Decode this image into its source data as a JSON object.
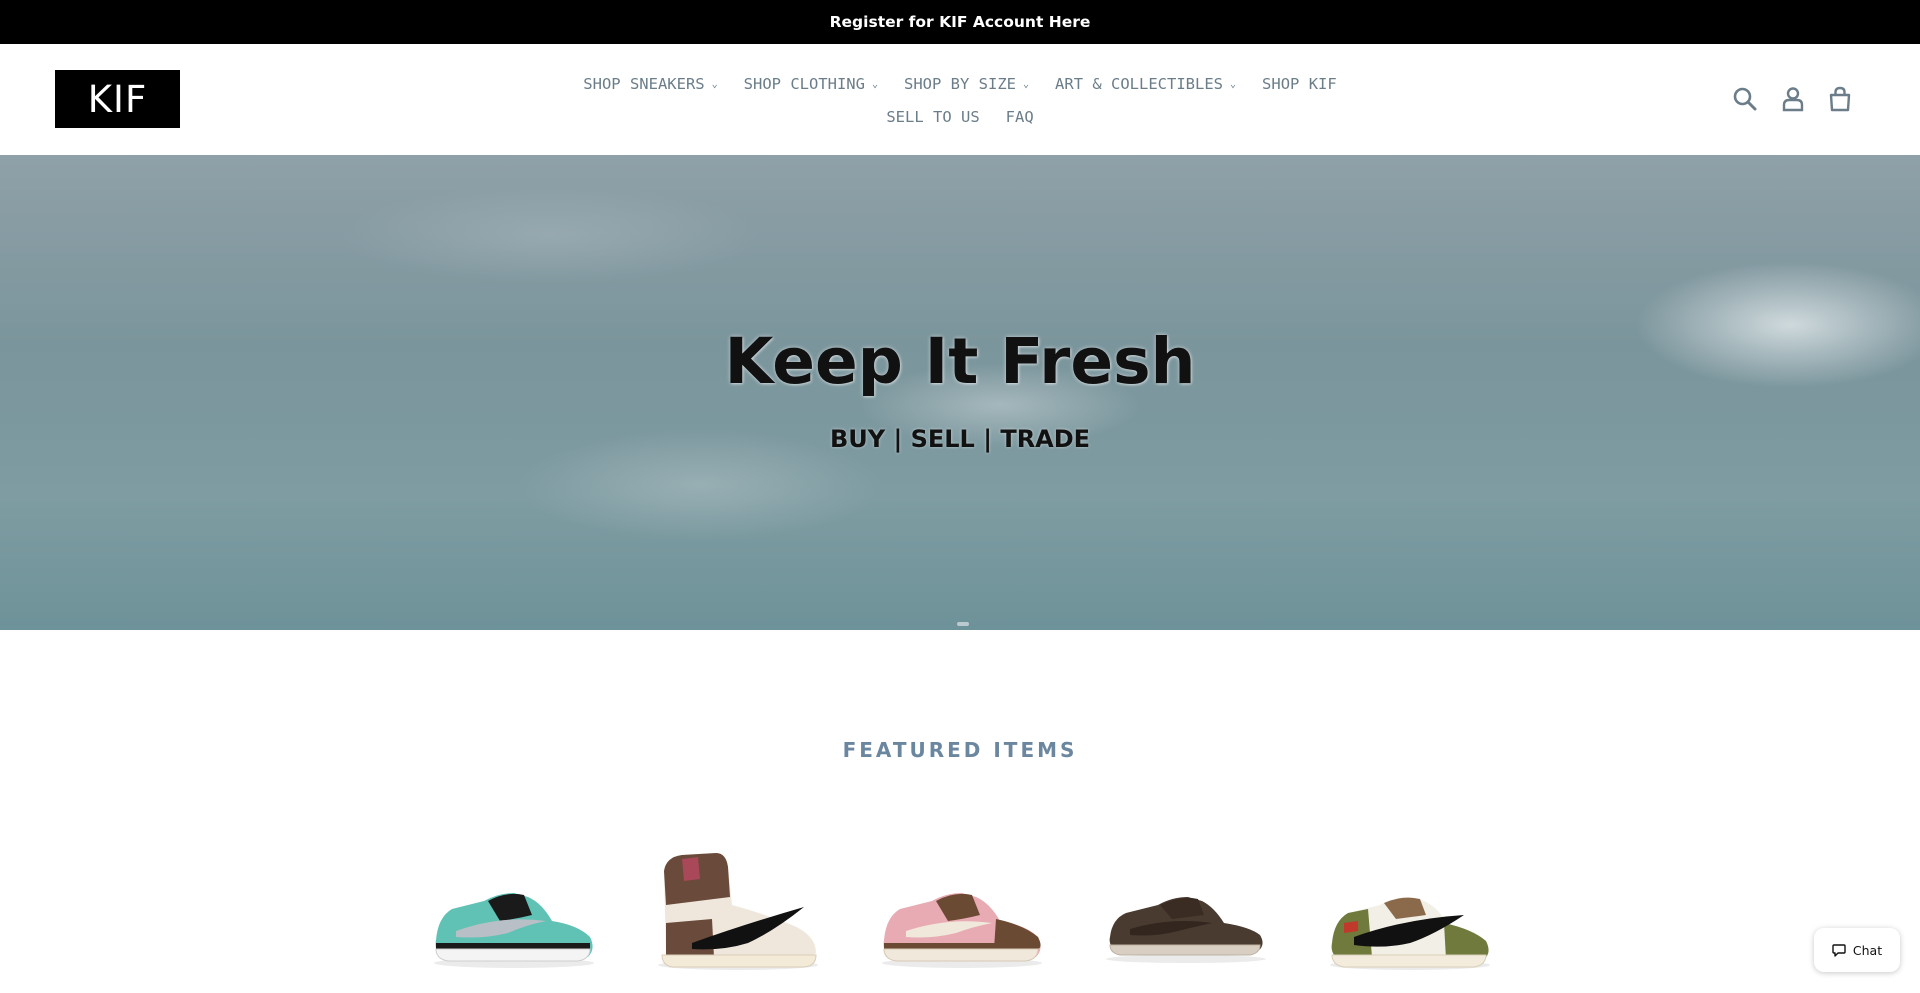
{
  "announcement": {
    "text": "Register for KIF Account Here"
  },
  "header": {
    "logo_text": "KIF",
    "nav": [
      {
        "label": "SHOP SNEAKERS",
        "has_dropdown": true
      },
      {
        "label": "SHOP CLOTHING",
        "has_dropdown": true
      },
      {
        "label": "SHOP BY SIZE",
        "has_dropdown": true
      },
      {
        "label": "ART & COLLECTIBLES",
        "has_dropdown": true
      },
      {
        "label": "SHOP KIF",
        "has_dropdown": false
      },
      {
        "label": "SELL TO US",
        "has_dropdown": false
      },
      {
        "label": "FAQ",
        "has_dropdown": false
      }
    ],
    "caret": "⌄",
    "icons": [
      "search-icon",
      "account-icon",
      "cart-icon"
    ]
  },
  "hero": {
    "title": "Keep It Fresh",
    "subtitle": "BUY | SELL | TRADE"
  },
  "featured": {
    "title": "FEATURED ITEMS",
    "products": [
      {
        "name": "tiffany-dunk-low",
        "colors": [
          "#5fc2b4",
          "#1a1a1a",
          "#b9bfc6"
        ]
      },
      {
        "name": "mocha-high",
        "colors": [
          "#6a4a3a",
          "#efe7dc",
          "#111111"
        ]
      },
      {
        "name": "pink-brown-dunk-low",
        "colors": [
          "#e8aab3",
          "#6b4a33",
          "#f1e8dc"
        ]
      },
      {
        "name": "dark-brown-low",
        "colors": [
          "#4a3b30",
          "#3a2c23",
          "#d8cfc2"
        ]
      },
      {
        "name": "olive-low",
        "colors": [
          "#6f7a3c",
          "#f2efe6",
          "#111111"
        ]
      }
    ]
  },
  "chat": {
    "label": "Chat"
  },
  "colors": {
    "announcement_bg": "#000000",
    "nav_text": "#6b7d89",
    "featured_title": "#6b87a0"
  }
}
